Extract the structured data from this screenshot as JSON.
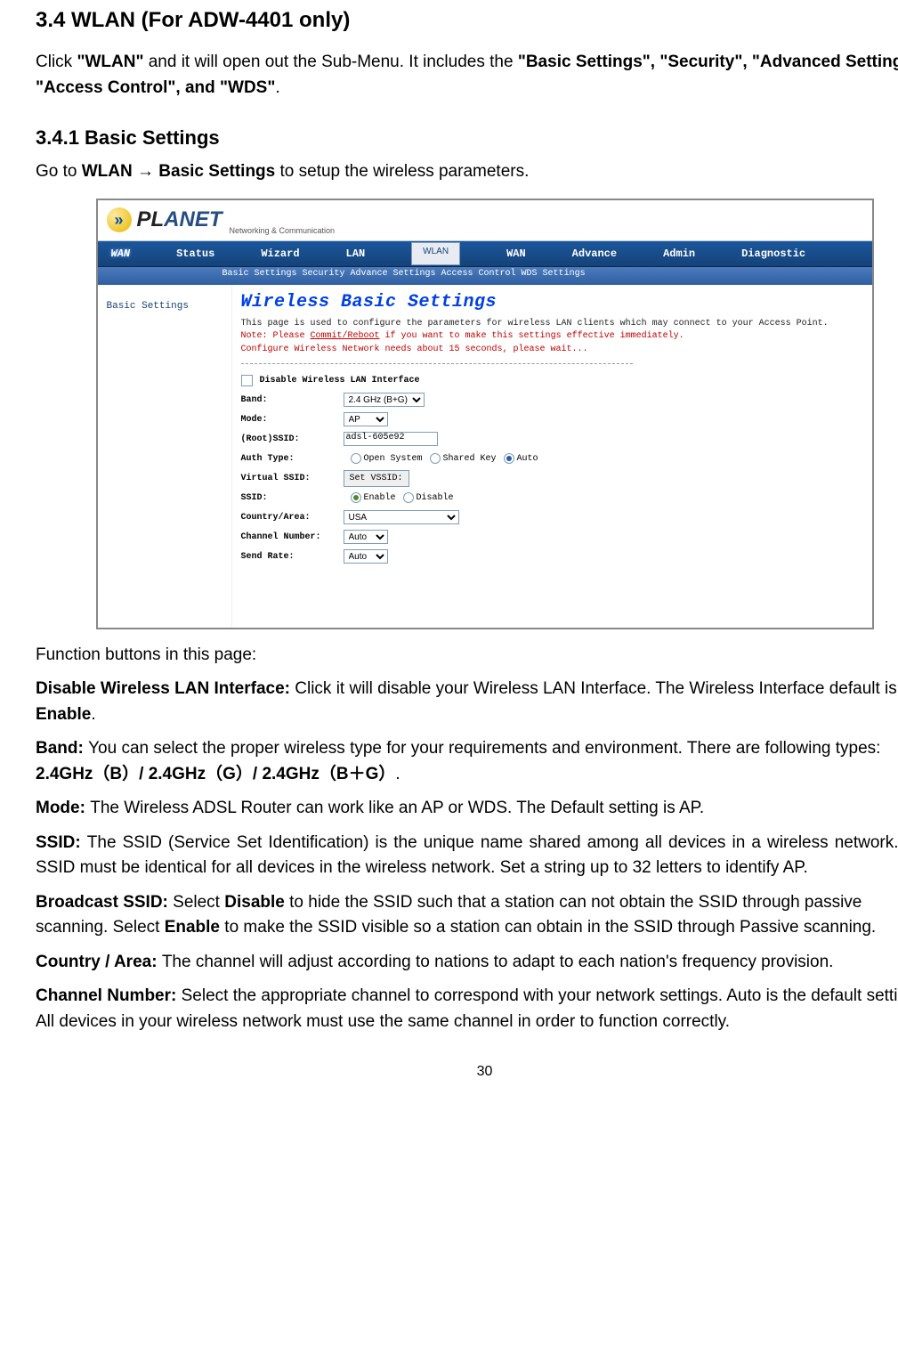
{
  "headings": {
    "h34": "3.4 WLAN (For ADW-4401 only)",
    "h341": "3.4.1 Basic Settings"
  },
  "intro": {
    "p1_a": "Click ",
    "p1_b": "\"WLAN\"",
    "p1_c": " and it will open out the Sub-Menu. It includes the ",
    "p1_d": "\"Basic Settings\", \"Security\", \"Advanced Settings\", \"Access Control\", and \"WDS\"",
    "p1_e": ".",
    "p2_a": "Go to ",
    "p2_b": "WLAN → Basic Settings",
    "p2_c": " to setup the wireless parameters."
  },
  "fig": {
    "logo_letter": "»",
    "logo_word_a": "PL",
    "logo_word_b": "ANET",
    "logo_sub": "Networking & Communication",
    "topnav": [
      "WAN",
      "Status",
      "Wizard",
      "LAN",
      "WLAN",
      "WAN",
      "Advance",
      "Admin",
      "Diagnostic"
    ],
    "subnav": "Basic Settings  Security  Advance Settings  Access Control  WDS Settings",
    "side": "Basic Settings",
    "title": "Wireless Basic Settings",
    "note1": "This page is used to configure the parameters for wireless LAN clients which may connect to your Access Point.",
    "note2_a": "Note: Please ",
    "note2_b": "Commit/Reboot",
    "note2_c": " if you want to make this settings effective immediately.",
    "note3": "Configure Wireless Network needs about 15 seconds, please wait...",
    "form": {
      "disable": "Disable Wireless LAN Interface",
      "band_l": "Band:",
      "band_v": "2.4 GHz (B+G)",
      "mode_l": "Mode:",
      "mode_v": "AP",
      "ssid_l": "(Root)SSID:",
      "ssid_v": "adsl-605e92",
      "auth_l": "Auth Type:",
      "auth_open": "Open System",
      "auth_shared": "Shared Key",
      "auth_auto": "Auto",
      "vssid_l": "Virtual SSID:",
      "vssid_btn": "Set VSSID:",
      "ssid2_l": "SSID:",
      "enable": "Enable",
      "disable2": "Disable",
      "country_l": "Country/Area:",
      "country_v": "USA",
      "chan_l": "Channel Number:",
      "chan_v": "Auto",
      "rate_l": "Send Rate:",
      "rate_v": "Auto"
    }
  },
  "func_intro": "Function buttons in this page:",
  "func": {
    "f1_a": "Disable Wireless LAN Interface: ",
    "f1_b": "Click it will disable your Wireless LAN Interface. The Wireless Interface default is ",
    "f1_c": "Enable",
    "f1_d": ".",
    "f2_a": "Band: ",
    "f2_b": "You can select the proper wireless type for your requirements and environment. There are following types: ",
    "f2_c": "2.4GHz（B）/ 2.4GHz（G）/ 2.4GHz（B＋G）",
    "f2_d": ".",
    "f3_a": "Mode: ",
    "f3_b": "The Wireless ADSL Router can work like an AP or WDS. The Default setting is AP.",
    "f4_a": "SSID: ",
    "f4_b": "The SSID (Service Set Identification) is the unique name shared among all devices in a wireless network. The SSID must be identical for all devices in the wireless network. Set a string up to 32 letters to identify AP.",
    "f5_a": "Broadcast SSID: ",
    "f5_b": "Select ",
    "f5_c": "Disable",
    "f5_d": " to hide the SSID such that a station can not obtain the SSID through passive scanning. Select ",
    "f5_e": "Enable",
    "f5_f": " to make the SSID visible so a station can obtain in the SSID through Passive scanning.",
    "f6_a": "Country / Area: ",
    "f6_b": "The channel will adjust according to nations to adapt to each nation's frequency provision.",
    "f7_a": "Channel Number: ",
    "f7_b": "Select the appropriate channel to correspond with your network settings. Auto is the default setting. All devices in your wireless network must use the same channel in order to function correctly."
  },
  "page_number": "30"
}
